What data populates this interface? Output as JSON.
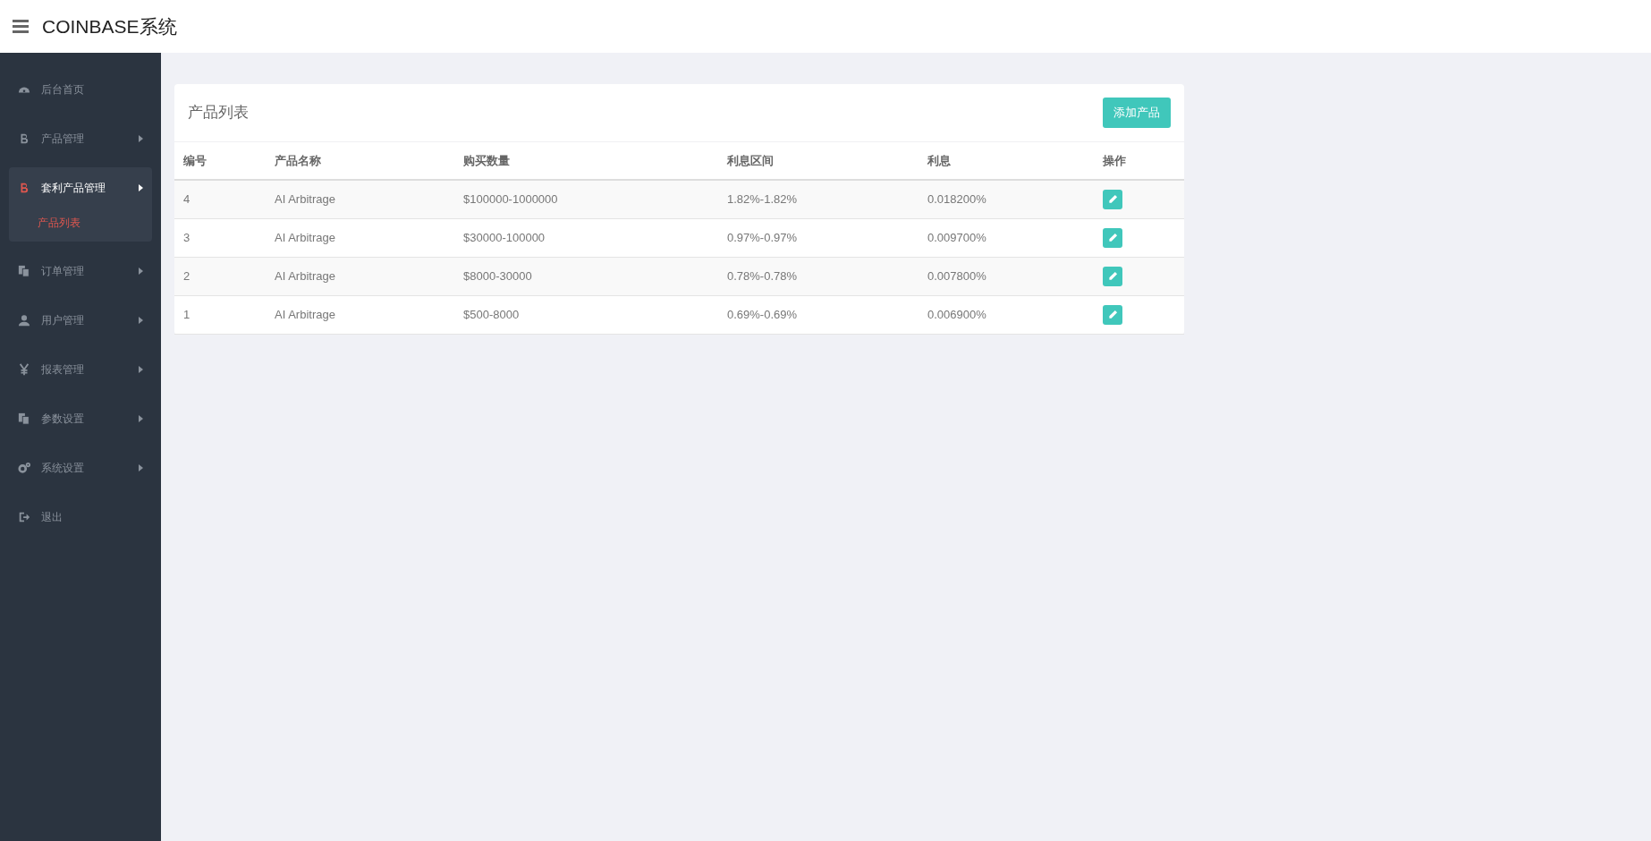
{
  "header": {
    "logo": "COINBASE系统"
  },
  "sidebar": {
    "items": [
      {
        "kind": "dashboard",
        "label": "后台首页",
        "has_arrow": false,
        "selected": false,
        "expanded": false
      },
      {
        "kind": "bitcoin",
        "label": "产品管理",
        "has_arrow": true,
        "selected": false,
        "expanded": false
      },
      {
        "kind": "bitcoin",
        "label": "套利产品管理",
        "has_arrow": true,
        "selected": true,
        "expanded": true,
        "children": [
          {
            "label": "产品列表",
            "selected": true
          }
        ]
      },
      {
        "kind": "copy",
        "label": "订单管理",
        "has_arrow": true,
        "selected": false,
        "expanded": false
      },
      {
        "kind": "user",
        "label": "用户管理",
        "has_arrow": true,
        "selected": false,
        "expanded": false
      },
      {
        "kind": "yen",
        "label": "报表管理",
        "has_arrow": true,
        "selected": false,
        "expanded": false
      },
      {
        "kind": "copy",
        "label": "参数设置",
        "has_arrow": true,
        "selected": false,
        "expanded": false
      },
      {
        "kind": "gears",
        "label": "系统设置",
        "has_arrow": true,
        "selected": false,
        "expanded": false
      },
      {
        "kind": "signout",
        "label": "退出",
        "has_arrow": false,
        "selected": false,
        "expanded": false
      }
    ]
  },
  "card": {
    "title": "产品列表",
    "add_button": "添加产品",
    "table": {
      "columns": [
        "编号",
        "产品名称",
        "购买数量",
        "利息区间",
        "利息",
        "操作"
      ],
      "rows": [
        [
          "4",
          "AI Arbitrage",
          "$100000-1000000",
          "1.82%-1.82%",
          "0.018200%"
        ],
        [
          "3",
          "AI Arbitrage",
          "$30000-100000",
          "0.97%-0.97%",
          "0.009700%"
        ],
        [
          "2",
          "AI Arbitrage",
          "$8000-30000",
          "0.78%-0.78%",
          "0.007800%"
        ],
        [
          "1",
          "AI Arbitrage",
          "$500-8000",
          "0.69%-0.69%",
          "0.006900%"
        ]
      ]
    }
  }
}
